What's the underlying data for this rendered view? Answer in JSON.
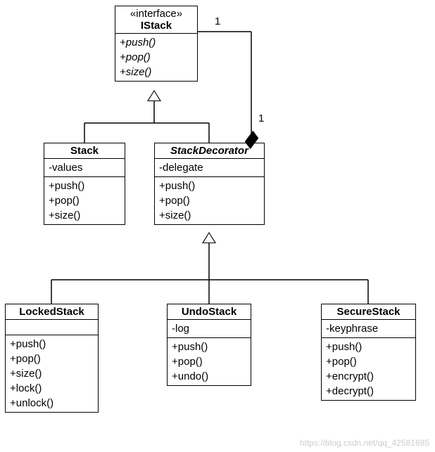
{
  "chart_data": {
    "type": "uml-class-diagram",
    "classes": [
      {
        "id": "istack",
        "name": "IStack",
        "stereotype": "«interface»",
        "italic": false,
        "attributes": [],
        "operations": [
          "+push()",
          "+pop()",
          "+size()"
        ],
        "operations_italic": true
      },
      {
        "id": "stack",
        "name": "Stack",
        "attributes": [
          "-values"
        ],
        "operations": [
          "+push()",
          "+pop()",
          "+size()"
        ]
      },
      {
        "id": "decorator",
        "name": "StackDecorator",
        "italic": true,
        "attributes": [
          "-delegate"
        ],
        "operations": [
          "+push()",
          "+pop()",
          "+size()"
        ]
      },
      {
        "id": "locked",
        "name": "LockedStack",
        "attributes": [],
        "operations": [
          "+push()",
          "+pop()",
          "+size()",
          "+lock()",
          "+unlock()"
        ]
      },
      {
        "id": "undo",
        "name": "UndoStack",
        "attributes": [
          "-log"
        ],
        "operations": [
          "+push()",
          "+pop()",
          "+undo()"
        ]
      },
      {
        "id": "secure",
        "name": "SecureStack",
        "attributes": [
          "-keyphrase"
        ],
        "operations": [
          "+push()",
          "+pop()",
          "+encrypt()",
          "+decrypt()"
        ]
      }
    ],
    "relationships": [
      {
        "type": "generalization",
        "from": "stack",
        "to": "istack"
      },
      {
        "type": "generalization",
        "from": "decorator",
        "to": "istack"
      },
      {
        "type": "generalization",
        "from": "locked",
        "to": "decorator"
      },
      {
        "type": "generalization",
        "from": "undo",
        "to": "decorator"
      },
      {
        "type": "generalization",
        "from": "secure",
        "to": "decorator"
      },
      {
        "type": "composition",
        "from": "decorator",
        "to": "istack",
        "multiplicity_from": "1",
        "multiplicity_to": "1"
      }
    ]
  },
  "mult": {
    "top": "1",
    "bottom": "1"
  },
  "watermark": "https://blog.csdn.net/qq_42581685"
}
